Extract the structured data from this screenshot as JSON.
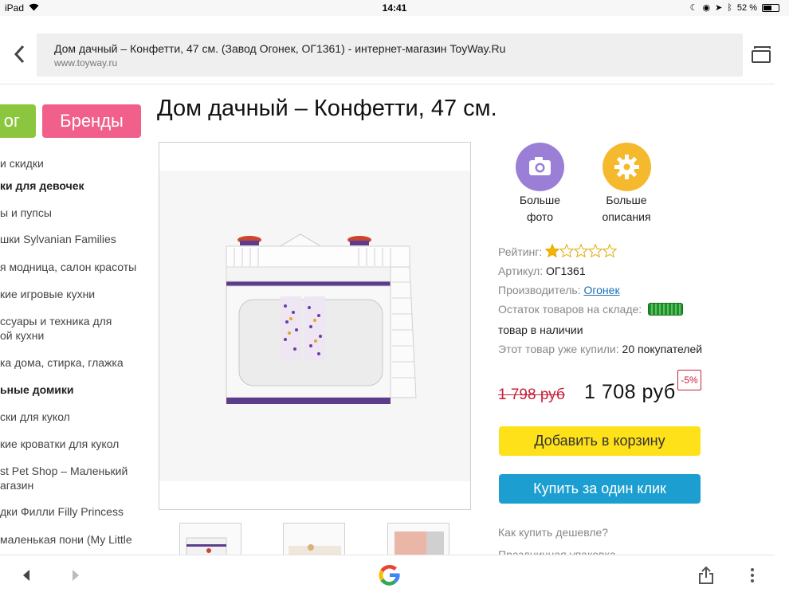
{
  "status_bar": {
    "device": "iPad",
    "time": "14:41",
    "battery": "52 %"
  },
  "browser": {
    "page_title": "Дом дачный – Конфетти, 47 см. (Завод Огонек, ОГ1361) - интернет-магазин ToyWay.Ru",
    "host": "www.toyway.ru"
  },
  "sidebar": {
    "catalog_label": "ог",
    "brands_label": "Бренды",
    "items": [
      {
        "label": "и скидки",
        "bold": false
      },
      {
        "label": "ки для девочек",
        "bold": true
      },
      {
        "label": "ы и пупсы",
        "bold": false
      },
      {
        "label": "шки Sylvanian Families",
        "bold": false
      },
      {
        "label": "я модница, салон красоты",
        "bold": false
      },
      {
        "label": "кие игровые кухни",
        "bold": false
      },
      {
        "label": "ссуары и техника для",
        "bold": false
      },
      {
        "label": "ой кухни",
        "bold": false
      },
      {
        "label": "ка дома, стирка, глажка",
        "bold": false
      },
      {
        "label": "ьные домики",
        "bold": true
      },
      {
        "label": "ски для кукол",
        "bold": false
      },
      {
        "label": "кие кроватки для кукол",
        "bold": false
      },
      {
        "label": "st Pet Shop – Маленький",
        "bold": false
      },
      {
        "label": "агазин",
        "bold": false
      },
      {
        "label": "дки Филли Filly Princess",
        "bold": false
      },
      {
        "label": "маленькая пони (My Little",
        "bold": false
      }
    ]
  },
  "product": {
    "title": "Дом дачный – Конфетти, 47 см.",
    "more_photo_line1": "Больше",
    "more_photo_line2": "фото",
    "more_desc_line1": "Больше",
    "more_desc_line2": "описания",
    "rating_label": "Рейтинг:",
    "rating_value": 1,
    "rating_max": 5,
    "article_label": "Артикул:",
    "article_value": "ОГ1361",
    "maker_label": "Производитель:",
    "maker_value": "Огонек",
    "stock_label": "Остаток товаров на складе:",
    "stock_status": "товар в наличии",
    "bought_label": "Этот товар уже купили:",
    "bought_value": "20 покупателей",
    "old_price": "1 798  руб",
    "new_price": "1 708  руб",
    "discount": "-5%",
    "add_to_cart": "Добавить в корзину",
    "buy_one_click": "Купить за один клик",
    "how_cheaper": "Как купить дешевле?",
    "gift_wrap": "Праздничная упаковка"
  },
  "colors": {
    "catalog_green": "#8cc63f",
    "brands_pink": "#f0608b",
    "photo_circle": "#9b7fd6",
    "desc_circle": "#f5b92e",
    "cart_yellow": "#ffe11a",
    "oneclick_blue": "#1c9fd0",
    "price_red": "#c8203a"
  }
}
